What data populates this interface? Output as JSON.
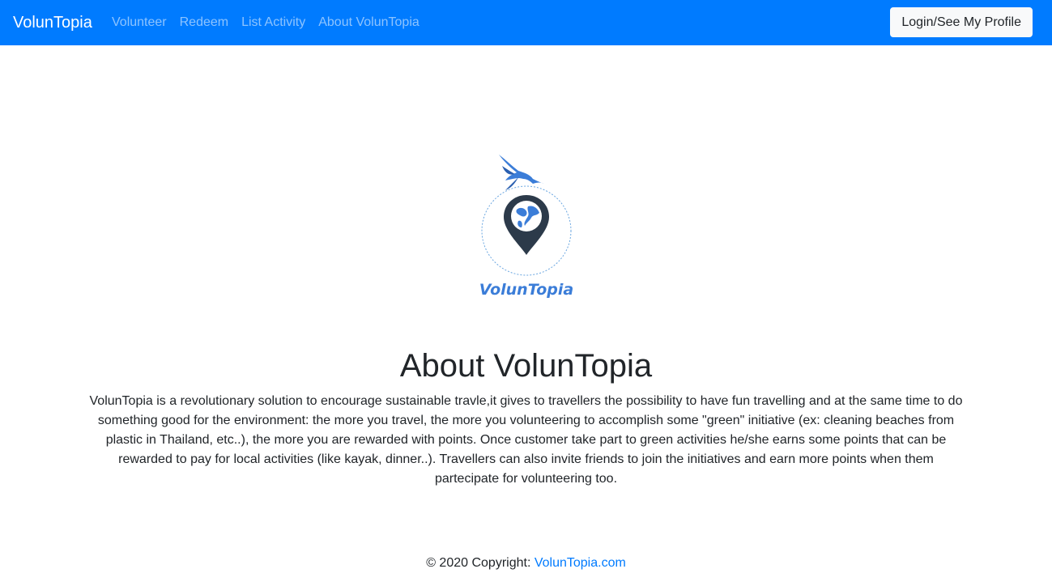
{
  "navbar": {
    "brand": "VolunTopia",
    "links": [
      "Volunteer",
      "Redeem",
      "List Activity",
      "About VolunTopia"
    ],
    "login_label": "Login/See My Profile",
    "bg_color": "#007bff"
  },
  "logo": {
    "wordmark": "VolunTopia",
    "icons": [
      "hummingbird-icon",
      "map-pin-icon",
      "globe-icon"
    ],
    "accent_color": "#3b7dd8",
    "pin_color": "#2c3a4a"
  },
  "main": {
    "title": "About VolunTopia",
    "description": "VolunTopia is a revolutionary solution to encourage sustainable travle,it gives to travellers the possibility to have fun travelling and at the same time to do something good for the environment: the more you travel, the more you volunteering to accomplish some \"green\" initiative (ex: cleaning beaches from plastic in Thailand, etc..), the more you are rewarded with points. Once customer take part to green activities he/she earns some points that can be rewarded to pay for local activities (like kayak, dinner..). Travellers can also invite friends to join the initiatives and earn more points when them partecipate for volunteering too."
  },
  "footer": {
    "copyright": "© 2020 Copyright: ",
    "link_text": "VolunTopia.com"
  }
}
